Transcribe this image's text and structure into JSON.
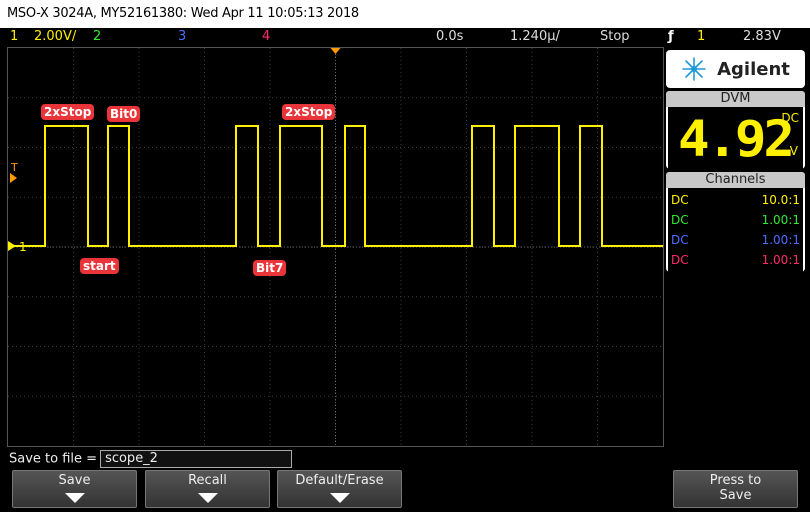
{
  "title": "MSO-X 3024A, MY52161380: Wed Apr 11 10:05:13 2018",
  "status": {
    "ch1_num": "1",
    "ch1_scale": "2.00V/",
    "ch2_num": "2",
    "ch3_num": "3",
    "ch4_num": "4",
    "delay": "0.0s",
    "timebase": "1.240µ/",
    "run": "Stop",
    "trig_icon": "ƒ",
    "trig_ch": "1",
    "trig_level": "2.83V"
  },
  "screen": {
    "annotations": [
      "2xStop",
      "Bit0",
      "start",
      "2xStop",
      "Bit7"
    ],
    "ch1_marker": "1",
    "trig_marker": "T"
  },
  "panel": {
    "brand": "Agilent",
    "dvm_header": "DVM",
    "dvm_value": "4.92",
    "dvm_mode": "DC",
    "dvm_unit": "V",
    "channels_header": "Channels",
    "channels": [
      {
        "coupling": "DC",
        "probe": "10.0:1",
        "color": "#ffef00"
      },
      {
        "coupling": "DC",
        "probe": "1.00:1",
        "color": "#35e835"
      },
      {
        "coupling": "DC",
        "probe": "1.00:1",
        "color": "#4d6dff"
      },
      {
        "coupling": "DC",
        "probe": "1.00:1",
        "color": "#ff2a6d"
      }
    ]
  },
  "savebar": {
    "label": "Save to file =",
    "filename": "scope_2",
    "save": "Save",
    "recall": "Recall",
    "default_erase": "Default/Erase",
    "press_to_save": "Press to Save"
  },
  "colors": {
    "ch1": "#ffef00",
    "ch2": "#35e835",
    "ch3": "#4d6dff",
    "ch4": "#ff2a6d",
    "trigger": "#ff9a00"
  }
}
